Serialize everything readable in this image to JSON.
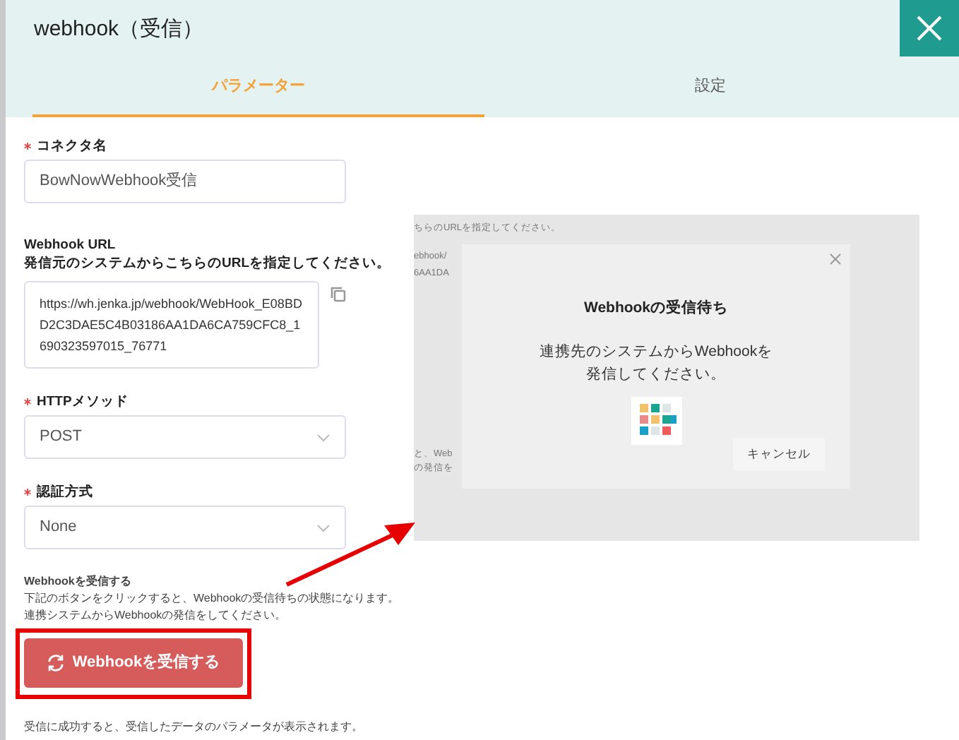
{
  "window": {
    "title": "webhook（受信）"
  },
  "tabs": [
    {
      "label": "パラメーター",
      "selected": true
    },
    {
      "label": "設定",
      "selected": false
    }
  ],
  "form": {
    "fields": [
      {
        "kind": "text",
        "label": "コネクタ名",
        "required": true,
        "value": "BowNowWebhook受信"
      },
      {
        "kind": "url",
        "label": "Webhook URL",
        "required": false,
        "hint": "発信元のシステムからこちらのURLを指定してください。",
        "value": "https://wh.jenka.jp/webhook/WebHook_E08BDD2C3DAE5C4B03186AA1DA6CA759CFC8_1690323597015_76771"
      },
      {
        "kind": "select",
        "label": "HTTPメソッド",
        "required": true,
        "value": "POST"
      },
      {
        "kind": "select",
        "label": "認証方式",
        "required": true,
        "value": "None"
      }
    ],
    "receive": {
      "title": "Webhookを受信する",
      "description": [
        "下記のボタンをクリックすると、Webhookの受信待ちの状態になります。",
        "連携システムからWebhookの発信をしてください。"
      ],
      "button": "Webhookを受信する"
    },
    "footer_note": "受信に成功すると、受信したデータのパラメータが表示されます。"
  },
  "preview": {
    "background_text": [
      "ちらのURLを指定してください。",
      "ebhook/",
      "6AA1DA",
      "と、Web",
      "の発信を"
    ],
    "modal": {
      "title": "Webhookの受信待ち",
      "message_lines": [
        "連携先のシステムからWebhookを",
        "発信してください。"
      ],
      "cancel": "キャンセル"
    }
  }
}
